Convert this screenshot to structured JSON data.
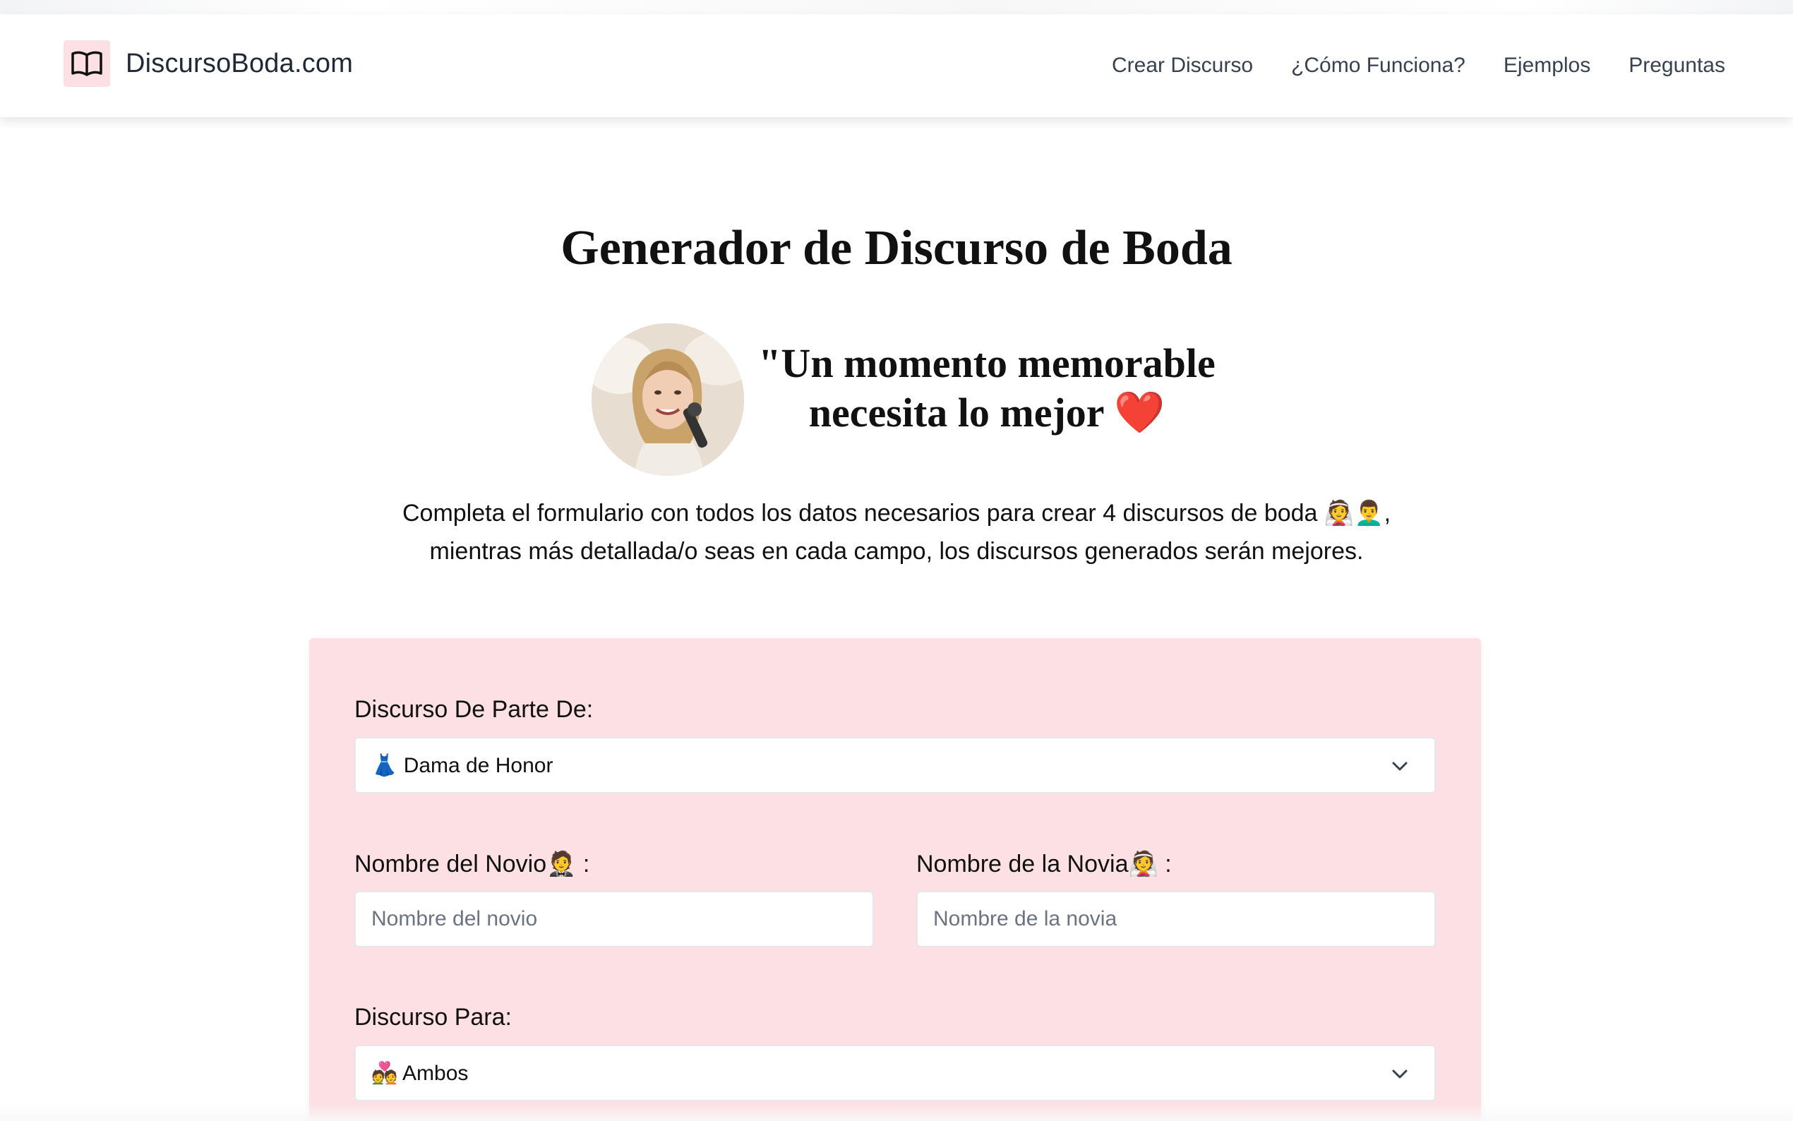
{
  "header": {
    "brand": "DiscursoBoda.com",
    "nav": [
      "Crear Discurso",
      "¿Cómo Funciona?",
      "Ejemplos",
      "Preguntas"
    ]
  },
  "hero": {
    "title": "Generador de Discurso de Boda",
    "quote_line1": "\"Un momento memorable",
    "quote_line2": "necesita lo mejor",
    "heart": "❤️",
    "intro_line1": "Completa el formulario con todos los datos necesarios para crear 4 discursos de boda 👰👨‍🦱,",
    "intro_line2": "mientras más detallada/o seas en cada campo, los discursos generados serán mejores."
  },
  "form": {
    "speech_from_label": "Discurso De Parte De:",
    "speech_from_value": "👗 Dama de Honor",
    "groom_label": "Nombre del Novio🤵 :",
    "groom_placeholder": "Nombre del novio",
    "bride_label": "Nombre de la Novia👰 :",
    "bride_placeholder": "Nombre de la novia",
    "speech_for_label": "Discurso Para:",
    "speech_for_value": "💑 Ambos"
  },
  "colors": {
    "card_bg": "#fde0e4",
    "logo_bg": "#fde0e4",
    "heart": "#e11d2a"
  },
  "icons": {
    "logo": "open-book-icon",
    "select_arrow": "chevron-down-icon"
  }
}
